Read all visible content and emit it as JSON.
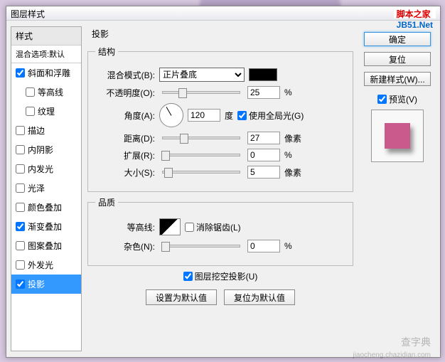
{
  "window": {
    "title": "图层样式"
  },
  "watermark": {
    "text": "脚本之家",
    "url": "JB51.Net",
    "bottom": "查字典",
    "bottom_url": "jiaocheng.chazidian.com"
  },
  "sidebar": {
    "header": "样式",
    "sub": "混合选项:默认",
    "items": [
      {
        "label": "斜面和浮雕",
        "checked": true
      },
      {
        "label": "等高线",
        "checked": false,
        "indent": true
      },
      {
        "label": "纹理",
        "checked": false,
        "indent": true
      },
      {
        "label": "描边",
        "checked": false
      },
      {
        "label": "内阴影",
        "checked": false
      },
      {
        "label": "内发光",
        "checked": false
      },
      {
        "label": "光泽",
        "checked": false
      },
      {
        "label": "颜色叠加",
        "checked": false
      },
      {
        "label": "渐变叠加",
        "checked": true
      },
      {
        "label": "图案叠加",
        "checked": false
      },
      {
        "label": "外发光",
        "checked": false
      },
      {
        "label": "投影",
        "checked": true,
        "selected": true
      }
    ]
  },
  "main": {
    "section_title": "投影",
    "structure": {
      "legend": "结构",
      "blend_label": "混合模式(B):",
      "blend_value": "正片叠底",
      "opacity_label": "不透明度(O):",
      "opacity_value": "25",
      "opacity_unit": "%",
      "angle_label": "角度(A):",
      "angle_value": "120",
      "angle_unit": "度",
      "global_light_label": "使用全局光(G)",
      "global_light_checked": true,
      "distance_label": "距离(D):",
      "distance_value": "27",
      "distance_unit": "像素",
      "spread_label": "扩展(R):",
      "spread_value": "0",
      "spread_unit": "%",
      "size_label": "大小(S):",
      "size_value": "5",
      "size_unit": "像素"
    },
    "quality": {
      "legend": "品质",
      "contour_label": "等高线:",
      "antialias_label": "消除锯齿(L)",
      "noise_label": "杂色(N):",
      "noise_value": "0",
      "noise_unit": "%"
    },
    "knockout_label": "图层挖空投影(U)",
    "knockout_checked": true,
    "btn_default": "设置为默认值",
    "btn_reset": "复位为默认值"
  },
  "buttons": {
    "ok": "确定",
    "cancel": "复位",
    "newstyle": "新建样式(W)...",
    "preview_label": "预览(V)",
    "preview_checked": true
  }
}
